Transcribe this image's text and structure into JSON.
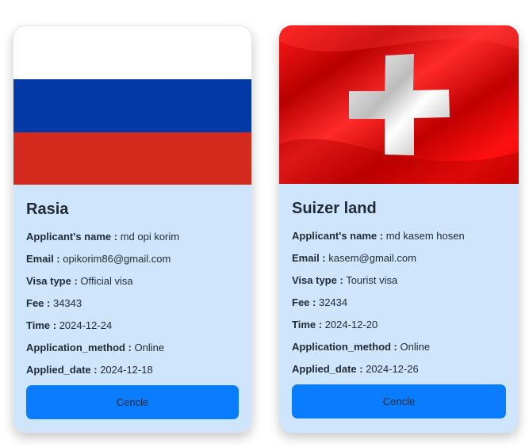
{
  "cards": [
    {
      "flag_image": "russia-flag",
      "flag_colors": [
        "#ffffff",
        "#0339a6",
        "#d52b1e"
      ],
      "country": "Rasia",
      "applicant_label": "Applicant's name :",
      "applicant_value": "md opi korim",
      "email_label": "Email :",
      "email_value": "opikorim86@gmail.com",
      "visa_label": "Visa type :",
      "visa_value": "Official visa",
      "fee_label": "Fee :",
      "fee_value": "34343",
      "time_label": "Time :",
      "time_value": "2024-12-24",
      "method_label": "Application_method :",
      "method_value": "Online",
      "applied_label": "Applied_date :",
      "applied_value": "2024-12-18",
      "button_label": "Cencle"
    },
    {
      "flag_image": "switzerland-flag",
      "flag_colors": [
        "#e10000",
        "#ffffff"
      ],
      "country": "Suizer land",
      "applicant_label": "Applicant's name :",
      "applicant_value": "md kasem hosen",
      "email_label": "Email :",
      "email_value": "kasem@gmail.com",
      "visa_label": "Visa type :",
      "visa_value": "Tourist visa",
      "fee_label": "Fee :",
      "fee_value": "32434",
      "time_label": "Time :",
      "time_value": "2024-12-20",
      "method_label": "Application_method :",
      "method_value": "Online",
      "applied_label": "Applied_date :",
      "applied_value": "2024-12-26",
      "button_label": "Cencle"
    }
  ],
  "colors": {
    "card_background": "#cfe5fb",
    "button_background": "#0a7cff",
    "text": "#1f2937"
  }
}
